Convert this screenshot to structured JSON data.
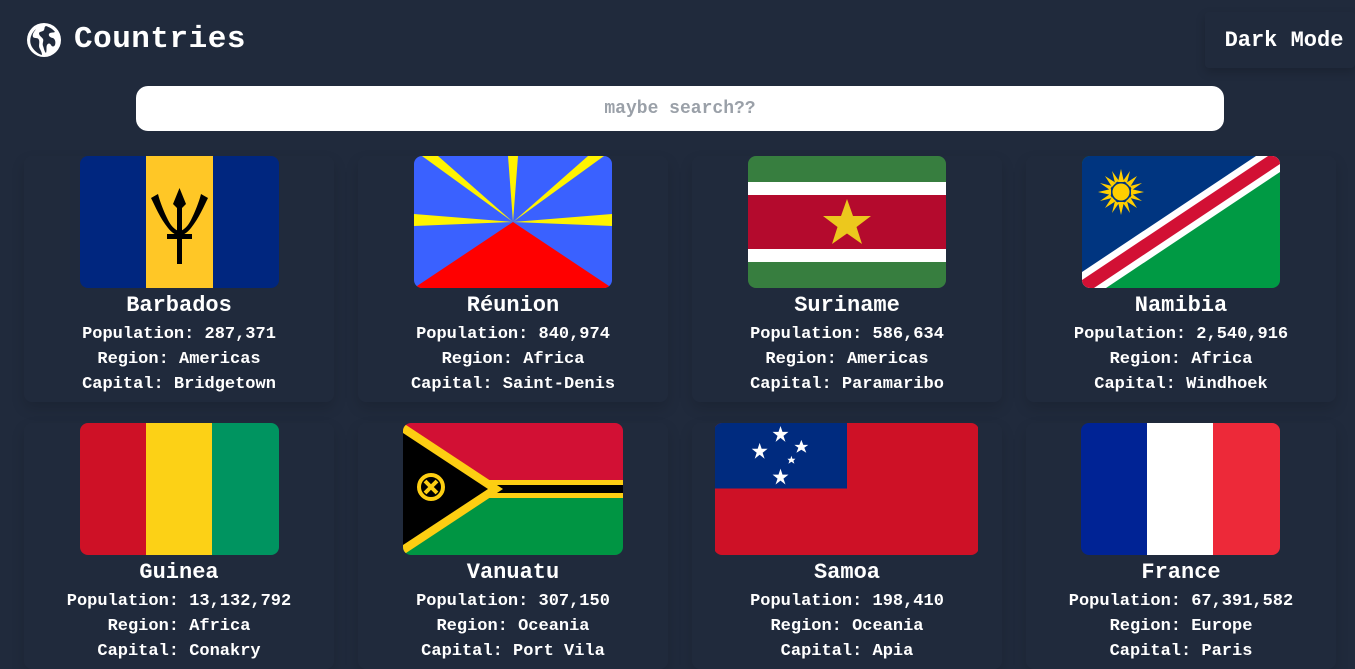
{
  "header": {
    "title": "Countries",
    "mode_toggle": "Dark Mode"
  },
  "search": {
    "placeholder": "maybe search??",
    "value": ""
  },
  "labels": {
    "population": "Population:",
    "region": "Region:",
    "capital": "Capital:"
  },
  "countries": [
    {
      "name": "Barbados",
      "population": "287,371",
      "region": "Americas",
      "capital": "Bridgetown",
      "flag_icon": "barbados-flag"
    },
    {
      "name": "Réunion",
      "population": "840,974",
      "region": "Africa",
      "capital": "Saint-Denis",
      "flag_icon": "reunion-flag"
    },
    {
      "name": "Suriname",
      "population": "586,634",
      "region": "Americas",
      "capital": "Paramaribo",
      "flag_icon": "suriname-flag"
    },
    {
      "name": "Namibia",
      "population": "2,540,916",
      "region": "Africa",
      "capital": "Windhoek",
      "flag_icon": "namibia-flag"
    },
    {
      "name": "Guinea",
      "population": "13,132,792",
      "region": "Africa",
      "capital": "Conakry",
      "flag_icon": "guinea-flag"
    },
    {
      "name": "Vanuatu",
      "population": "307,150",
      "region": "Oceania",
      "capital": "Port Vila",
      "flag_icon": "vanuatu-flag"
    },
    {
      "name": "Samoa",
      "population": "198,410",
      "region": "Oceania",
      "capital": "Apia",
      "flag_icon": "samoa-flag"
    },
    {
      "name": "France",
      "population": "67,391,582",
      "region": "Europe",
      "capital": "Paris",
      "flag_icon": "france-flag"
    }
  ],
  "colors": {
    "background": "#202a3c",
    "text": "#ffffff",
    "search_bg": "#ffffff"
  }
}
